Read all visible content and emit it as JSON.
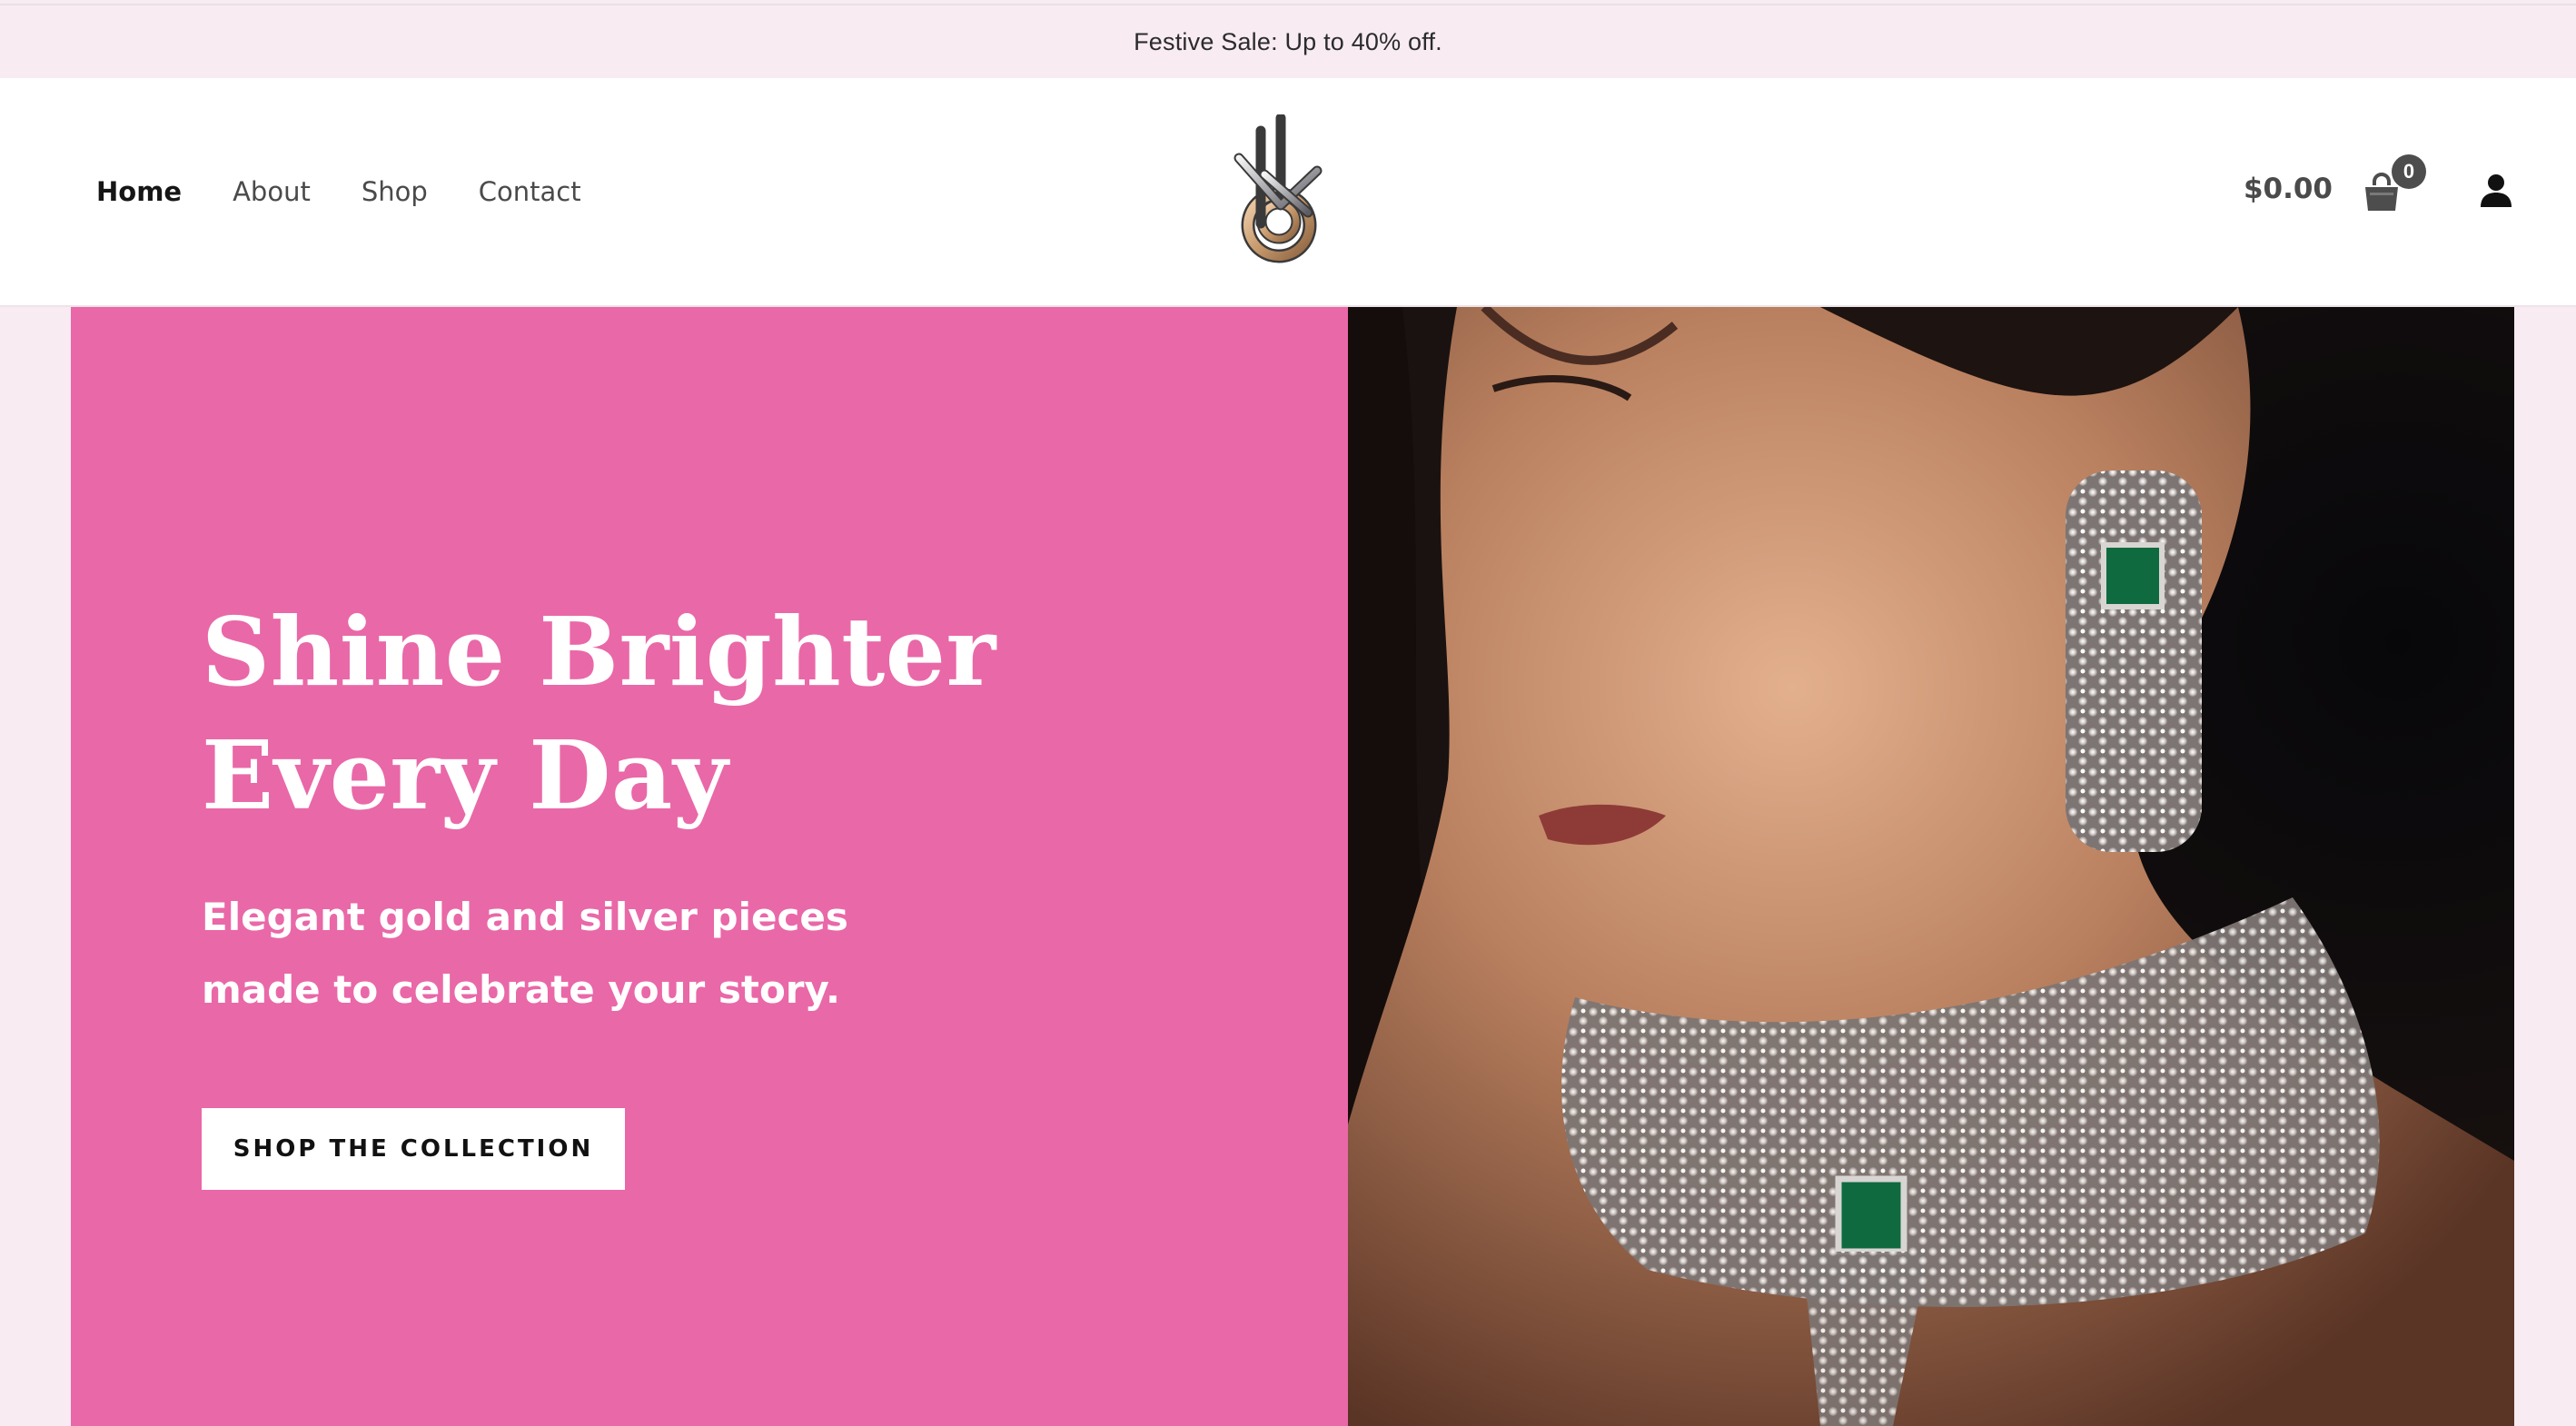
{
  "announcement": {
    "text": "Festive Sale: Up to 40% off."
  },
  "nav": {
    "items": [
      {
        "label": "Home"
      },
      {
        "label": "About"
      },
      {
        "label": "Shop"
      },
      {
        "label": "Contact"
      }
    ]
  },
  "header": {
    "logo_icon": "intertwined-rings-logo-icon",
    "cart_total": "$0.00",
    "cart_count": "0",
    "cart_icon": "shopping-bag-icon",
    "account_icon": "user-icon"
  },
  "hero": {
    "title_line1": "Shine Brighter",
    "title_line2": "Every Day",
    "subtitle_line1": "Elegant gold and silver pieces",
    "subtitle_line2": "made to celebrate your story.",
    "cta_label": "SHOP THE COLLECTION",
    "accent_color": "#e968a8"
  }
}
